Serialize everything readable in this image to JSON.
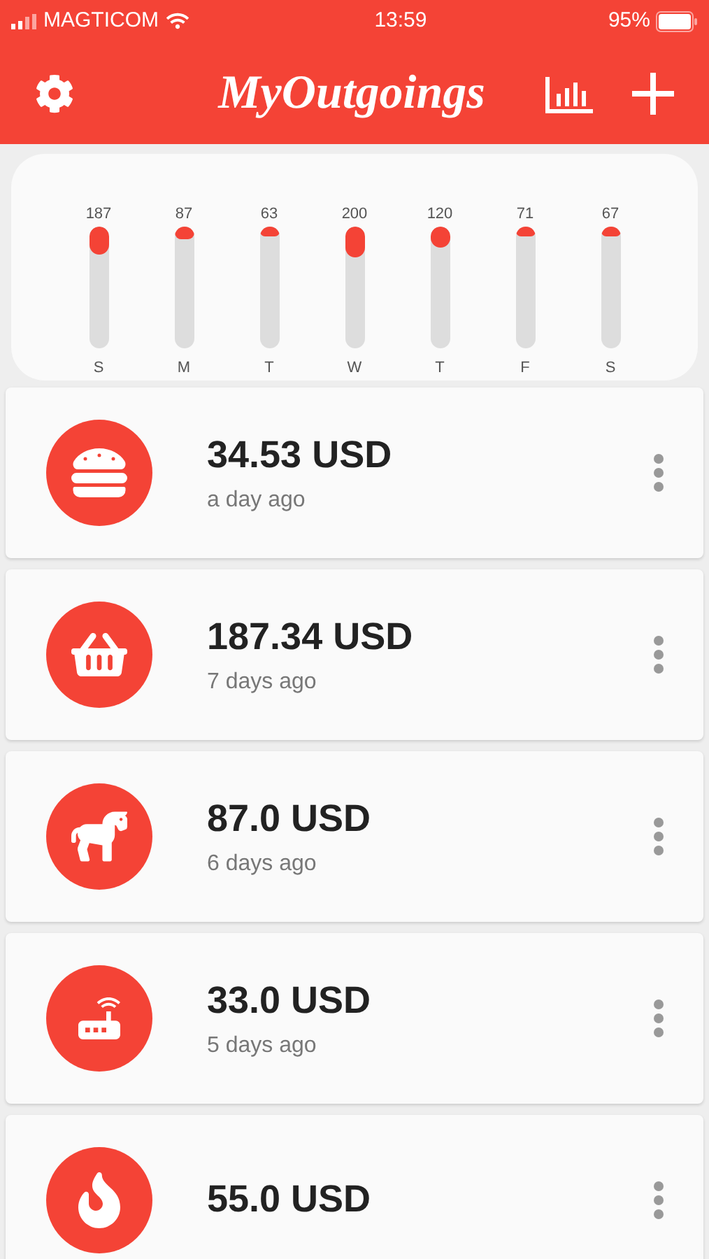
{
  "status_bar": {
    "carrier": "MAGTICOM",
    "time": "13:59",
    "battery": "95%"
  },
  "header": {
    "title": "MyOutgoings"
  },
  "weekly_meters": [
    {
      "day": "S",
      "value": "187",
      "level": 0.23
    },
    {
      "day": "M",
      "value": "87",
      "level": 0.1
    },
    {
      "day": "T",
      "value": "63",
      "level": 0.08
    },
    {
      "day": "W",
      "value": "200",
      "level": 0.25
    },
    {
      "day": "T",
      "value": "120",
      "level": 0.17
    },
    {
      "day": "F",
      "value": "71",
      "level": 0.08
    },
    {
      "day": "S",
      "value": "67",
      "level": 0.08
    }
  ],
  "expenses": [
    {
      "kind": "food",
      "amount": "34.53 USD",
      "time": "a day ago"
    },
    {
      "kind": "shopping",
      "amount": "187.34 USD",
      "time": "7 days ago"
    },
    {
      "kind": "toy",
      "amount": "87.0 USD",
      "time": "6 days ago"
    },
    {
      "kind": "internet",
      "amount": "33.0 USD",
      "time": "5 days ago"
    },
    {
      "kind": "fire",
      "amount": "55.0 USD"
    }
  ]
}
